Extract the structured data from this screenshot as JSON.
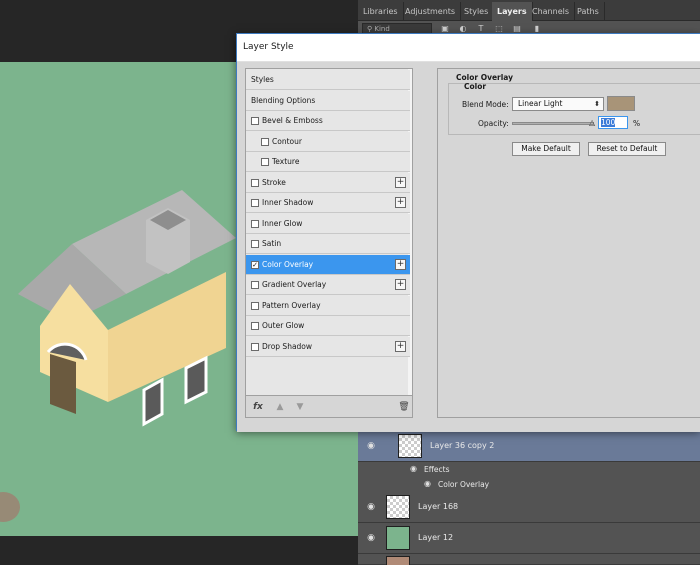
{
  "panel": {
    "tabs": [
      "Libraries",
      "Adjustments",
      "Styles",
      "Layers",
      "Channels",
      "Paths"
    ],
    "active_tab": "Layers",
    "filter_kind": "Kind"
  },
  "layers": {
    "selected": {
      "name": "Layer 36 copy 2"
    },
    "effects_label": "Effects",
    "effect_item": "Color Overlay",
    "layer_168": {
      "name": "Layer 168"
    },
    "layer_12": {
      "name": "Layer 12",
      "thumb_color": "#7cb48d"
    }
  },
  "dialog": {
    "title": "Layer Style",
    "styles": [
      {
        "label": "Styles",
        "checkbox": false,
        "plus": false,
        "indent": false
      },
      {
        "label": "Blending Options",
        "checkbox": false,
        "plus": false,
        "indent": false
      },
      {
        "label": "Bevel & Emboss",
        "checkbox": true,
        "checked": false,
        "plus": false,
        "indent": false
      },
      {
        "label": "Contour",
        "checkbox": true,
        "checked": false,
        "plus": false,
        "indent": true
      },
      {
        "label": "Texture",
        "checkbox": true,
        "checked": false,
        "plus": false,
        "indent": true
      },
      {
        "label": "Stroke",
        "checkbox": true,
        "checked": false,
        "plus": true,
        "indent": false
      },
      {
        "label": "Inner Shadow",
        "checkbox": true,
        "checked": false,
        "plus": true,
        "indent": false
      },
      {
        "label": "Inner Glow",
        "checkbox": true,
        "checked": false,
        "plus": false,
        "indent": false
      },
      {
        "label": "Satin",
        "checkbox": true,
        "checked": false,
        "plus": false,
        "indent": false
      },
      {
        "label": "Color Overlay",
        "checkbox": true,
        "checked": true,
        "plus": true,
        "indent": false,
        "active": true
      },
      {
        "label": "Gradient Overlay",
        "checkbox": true,
        "checked": false,
        "plus": true,
        "indent": false
      },
      {
        "label": "Pattern Overlay",
        "checkbox": true,
        "checked": false,
        "plus": false,
        "indent": false
      },
      {
        "label": "Outer Glow",
        "checkbox": true,
        "checked": false,
        "plus": false,
        "indent": false
      },
      {
        "label": "Drop Shadow",
        "checkbox": true,
        "checked": false,
        "plus": true,
        "indent": false
      }
    ],
    "footer_fx": "fx",
    "section_title": "Color Overlay",
    "group_title": "Color",
    "blend_mode_label": "Blend Mode:",
    "blend_mode_value": "Linear Light",
    "overlay_color": "#a89478",
    "opacity_label": "Opacity:",
    "opacity_value": "100",
    "opacity_unit": "%",
    "opacity_fraction": 1.0,
    "make_default": "Make Default",
    "reset_default": "Reset to Default"
  },
  "colors": {
    "accent": "#3b96ee",
    "canvas_green": "#7cb48d",
    "panel_bg": "#535353",
    "selected_layer": "#6a7a98"
  }
}
